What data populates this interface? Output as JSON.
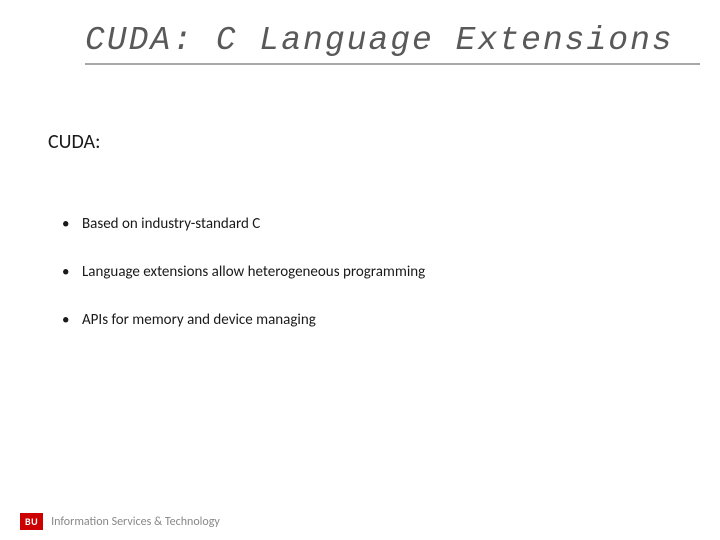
{
  "title": "CUDA: C Language Extensions",
  "subtitle": "CUDA:",
  "bullets": [
    "Based on industry-standard C",
    "Language extensions allow heterogeneous programming",
    "APIs for memory and device managing"
  ],
  "footer": {
    "logo": "BU",
    "text": "Information Services & Technology"
  }
}
